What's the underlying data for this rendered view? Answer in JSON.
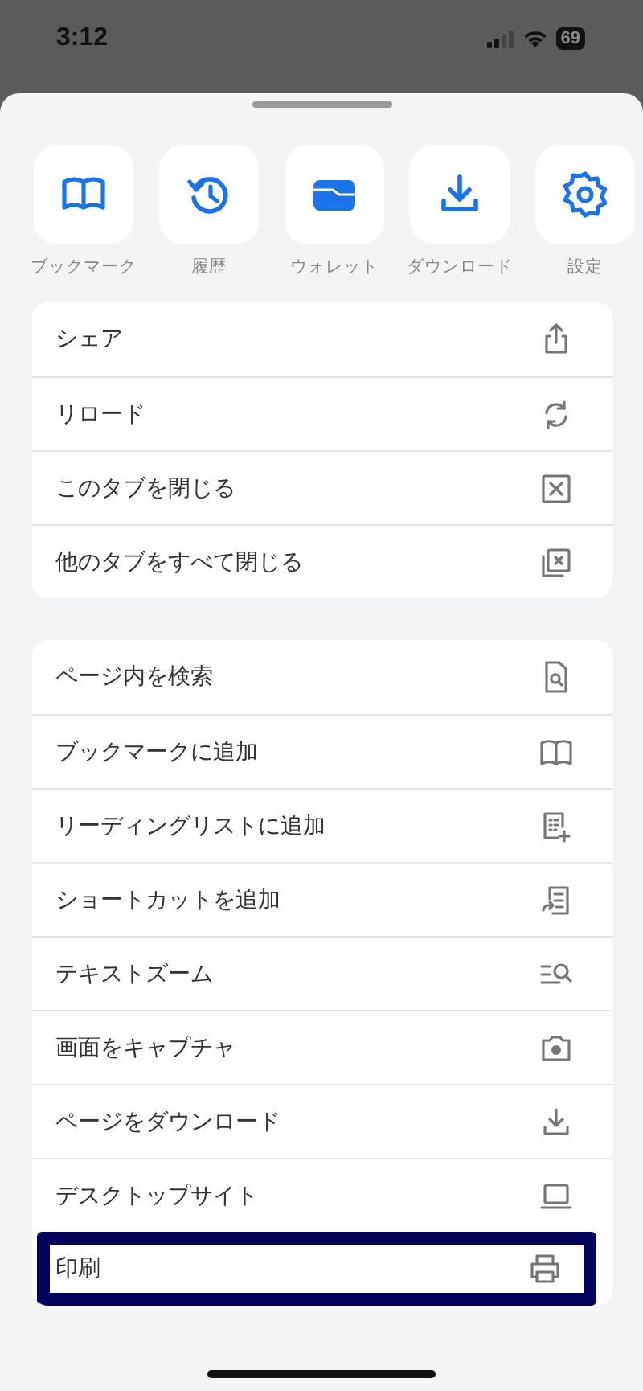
{
  "status_bar": {
    "time": "3:12",
    "battery": "69"
  },
  "quick_actions": [
    {
      "label": "ブックマーク"
    },
    {
      "label": "履歴"
    },
    {
      "label": "ウォレット"
    },
    {
      "label": "ダウンロード"
    },
    {
      "label": "設定"
    }
  ],
  "menu_groups": [
    {
      "items": [
        {
          "label": "シェア",
          "selected": false
        },
        {
          "label": "リロード",
          "selected": false
        },
        {
          "label": "このタブを閉じる",
          "selected": false
        },
        {
          "label": "他のタブをすべて閉じる",
          "selected": false
        }
      ]
    },
    {
      "items": [
        {
          "label": "ページ内を検索",
          "selected": false
        },
        {
          "label": "ブックマークに追加",
          "selected": false
        },
        {
          "label": "リーディングリストに追加",
          "selected": false
        },
        {
          "label": "ショートカットを追加",
          "selected": false
        },
        {
          "label": "テキストズーム",
          "selected": false
        },
        {
          "label": "画面をキャプチャ",
          "selected": false
        },
        {
          "label": "ページをダウンロード",
          "selected": false
        },
        {
          "label": "デスクトップサイト",
          "selected": false
        },
        {
          "label": "印刷",
          "selected": true
        }
      ]
    }
  ]
}
